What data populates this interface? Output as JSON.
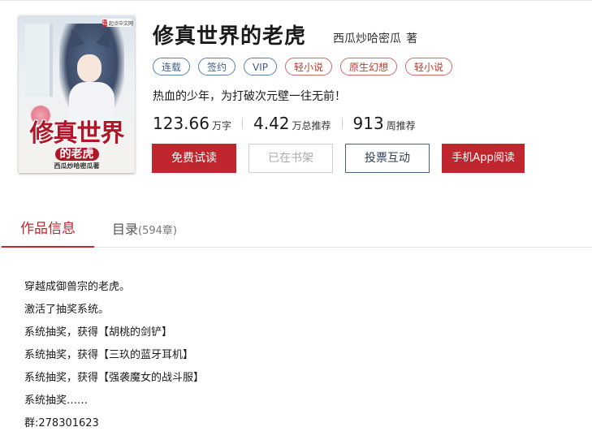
{
  "cover": {
    "badge": "起点中文网",
    "title": "修真世界",
    "subtitle": "的老虎",
    "author": "西瓜炒哈密瓜著"
  },
  "book": {
    "title": "修真世界的老虎",
    "author": "西瓜炒哈密瓜",
    "author_suffix": "著",
    "tags": [
      {
        "label": "连载",
        "style": "blue"
      },
      {
        "label": "签约",
        "style": "blue"
      },
      {
        "label": "VIP",
        "style": "blue"
      },
      {
        "label": "轻小说",
        "style": "red"
      },
      {
        "label": "原生幻想",
        "style": "red"
      },
      {
        "label": "轻小说",
        "style": "red"
      }
    ],
    "intro": "热血的少年，为打破次元壁一往无前！",
    "stats": [
      {
        "value": "123.66",
        "unit": "万字"
      },
      {
        "value": "4.42",
        "unit": "万总推荐"
      },
      {
        "value": "913",
        "unit": "周推荐"
      }
    ]
  },
  "actions": {
    "free_read": "免费试读",
    "in_shelf": "已在书架",
    "vote": "投票互动",
    "app_read": "手机App阅读"
  },
  "tabs": {
    "info": "作品信息",
    "toc": "目录",
    "toc_count": "(594章)"
  },
  "description": [
    "穿越成御兽宗的老虎。",
    "激活了抽奖系统。",
    "系统抽奖，获得【胡桃的剑铲】",
    "系统抽奖，获得【三玖的蓝牙耳机】",
    "系统抽奖，获得【强袭魔女的战斗服】",
    "系统抽奖……",
    "群:278301623"
  ],
  "colors": {
    "accent": "#c0262d",
    "tag_blue": "#3f5f86",
    "tag_red": "#c0392b"
  }
}
